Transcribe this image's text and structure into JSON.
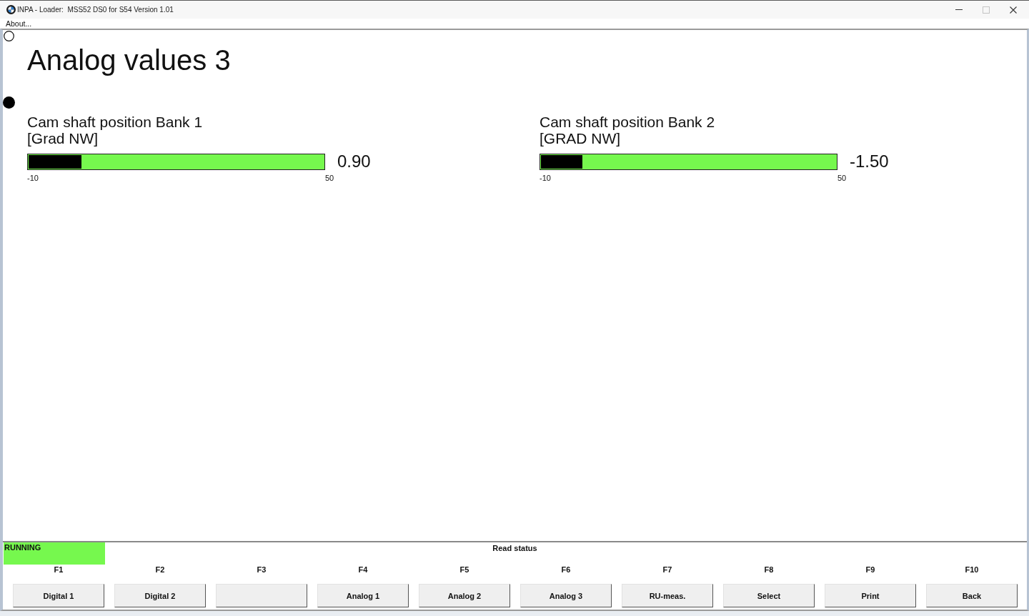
{
  "window": {
    "title": "INPA - Loader:  MSS52 DS0 for S54 Version 1.01",
    "maximize_enabled": false
  },
  "menu": [
    {
      "label": "About..."
    }
  ],
  "heading": "Analog values 3",
  "gauges": [
    {
      "name": "Cam shaft position Bank 1",
      "unit": "[Grad NW]",
      "level": 0.18,
      "reading": "0.90",
      "scale_min": "-10",
      "scale_max": "50"
    },
    {
      "name": "Cam shaft position Bank 2",
      "unit": "[GRAD NW]",
      "level": 0.14,
      "reading": "-1.50",
      "scale_min": "-10",
      "scale_max": "50"
    }
  ],
  "status": {
    "label": "RUNNING",
    "active": true,
    "message": "Read status"
  },
  "function_keys": [
    {
      "key": "F1",
      "label": "Digital 1"
    },
    {
      "key": "F2",
      "label": "Digital 2"
    },
    {
      "key": "F3"
    },
    {
      "key": "F4",
      "label": "Analog 1"
    },
    {
      "key": "F5",
      "label": "Analog 2"
    },
    {
      "key": "F6",
      "label": "Analog 3"
    },
    {
      "key": "F7",
      "label": "RU-meas."
    },
    {
      "key": "F8",
      "label": "Select"
    },
    {
      "key": "F9",
      "label": "Print"
    },
    {
      "key": "F10",
      "label": "Back"
    }
  ]
}
